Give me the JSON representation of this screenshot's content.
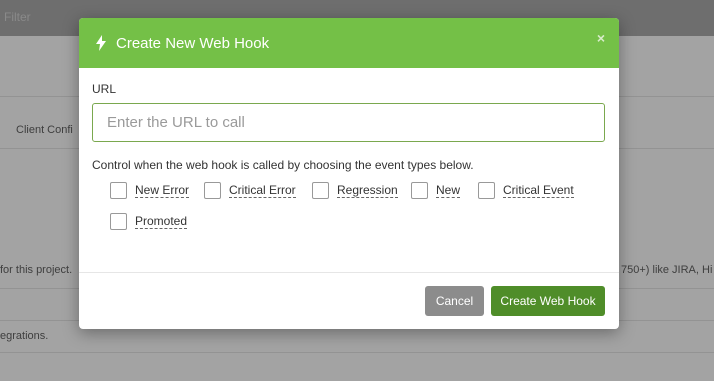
{
  "background": {
    "filter_label": "Filter",
    "client_config_text": "Client Confi",
    "project_text": "for this project.",
    "integrations_right_text": "750+) like JIRA, Hi",
    "integrations_text": "egrations."
  },
  "modal": {
    "title": "Create New Web Hook",
    "close_icon": "×",
    "url_label": "URL",
    "url_value": "",
    "url_placeholder": "Enter the URL to call",
    "control_help": "Control when the web hook is called by choosing the event types below.",
    "events": [
      {
        "label": "New Error",
        "checked": false
      },
      {
        "label": "Critical Error",
        "checked": false
      },
      {
        "label": "Regression",
        "checked": false
      },
      {
        "label": "New",
        "checked": false
      },
      {
        "label": "Critical Event",
        "checked": false
      },
      {
        "label": "Promoted",
        "checked": false
      }
    ],
    "cancel_label": "Cancel",
    "create_label": "Create Web Hook"
  },
  "colors": {
    "header_green": "#74c047",
    "create_button_green": "#4f8d29",
    "cancel_button_gray": "#8c8c8c",
    "input_border_green": "#7aa84e"
  }
}
